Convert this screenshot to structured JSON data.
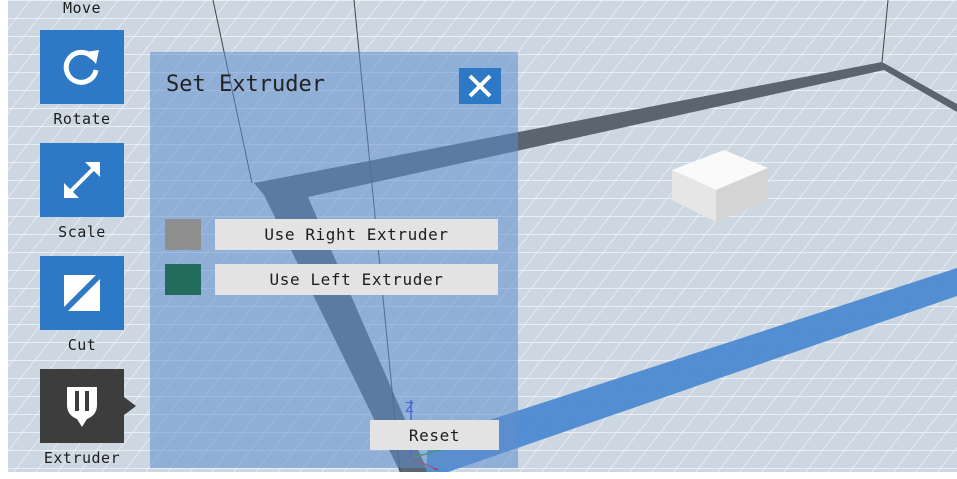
{
  "toolbar": {
    "move_label": "Move",
    "rotate_label": "Rotate",
    "scale_label": "Scale",
    "cut_label": "Cut",
    "extruder_label": "Extruder"
  },
  "extruder_panel": {
    "title": "Set Extruder",
    "right_extruder_label": "Use Right Extruder",
    "left_extruder_label": "Use Left Extruder",
    "right_swatch_color": "#8e8e8e",
    "left_swatch_color": "#236b5a"
  },
  "reset_label": "Reset",
  "axis_label_z": "Z",
  "colors": {
    "accent": "#2e79c5",
    "active_tool": "#3d3d3d",
    "build_plate": "#ccd6e1",
    "build_area_border": "#5a6570",
    "blue_extents": "#4a88d0"
  }
}
